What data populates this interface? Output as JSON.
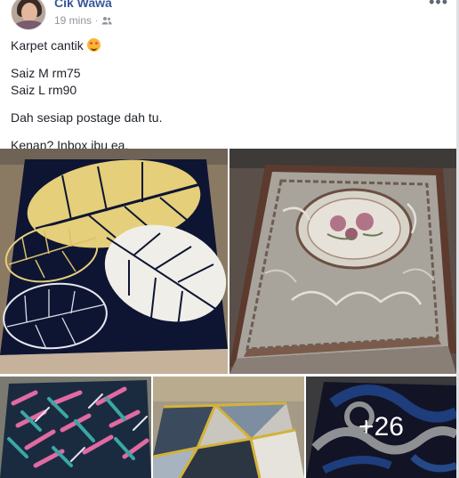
{
  "post": {
    "author": "Cik Wawa",
    "timestamp": "19 mins",
    "separator": "·",
    "privacy_icon": "friends-icon",
    "more_label": "•••",
    "lines": [
      "Karpet cantik",
      "Saiz M rm75",
      "Saiz L rm90",
      "Dah sesiap postage dah tu.",
      "Kenan? Inbox ibu ea."
    ],
    "emoji": "smiling-face-with-hearts",
    "more_photos_label": "+26"
  },
  "colors": {
    "author_link": "#385898",
    "meta_text": "#90949c",
    "body_text": "#1d2129"
  }
}
